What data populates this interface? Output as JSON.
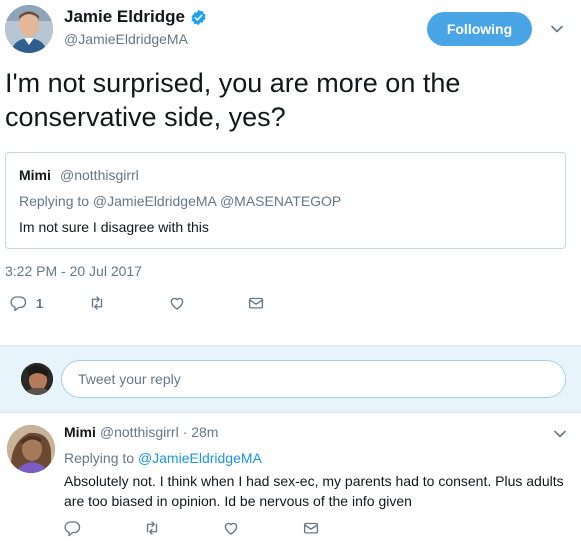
{
  "tweet": {
    "author_name": "Jamie Eldridge",
    "author_handle": "@JamieEldridgeMA",
    "follow_label": "Following",
    "text": "I'm not surprised, you are more on the conservative side, yes?",
    "timestamp": "3:22 PM - 20 Jul 2017",
    "reply_count": "1"
  },
  "quoted": {
    "name": "Mimi",
    "handle": "@notthisgirrl",
    "replying_to": "Replying to @JamieEldridgeMA @MASENATEGOP",
    "text": "Im not sure I disagree with this"
  },
  "compose": {
    "placeholder": "Tweet your reply"
  },
  "reply": {
    "name": "Mimi",
    "handle": "@notthisgirrl",
    "time": "· 28m",
    "replying_prefix": "Replying to",
    "replying_handle": "@JamieEldridgeMA",
    "text": "Absolutely not. I think when I had sex-ec, my parents had to consent. Plus adults are too biased in opinion. Id be nervous of the info given"
  },
  "colors": {
    "accent": "#1da1f2",
    "follow_bg": "#4aa5e6",
    "muted": "#657786",
    "reply_box_bg": "#e8f4fb"
  },
  "icons": [
    "verified-icon",
    "caret-down-icon",
    "reply-icon",
    "retweet-icon",
    "like-icon",
    "dm-icon"
  ]
}
